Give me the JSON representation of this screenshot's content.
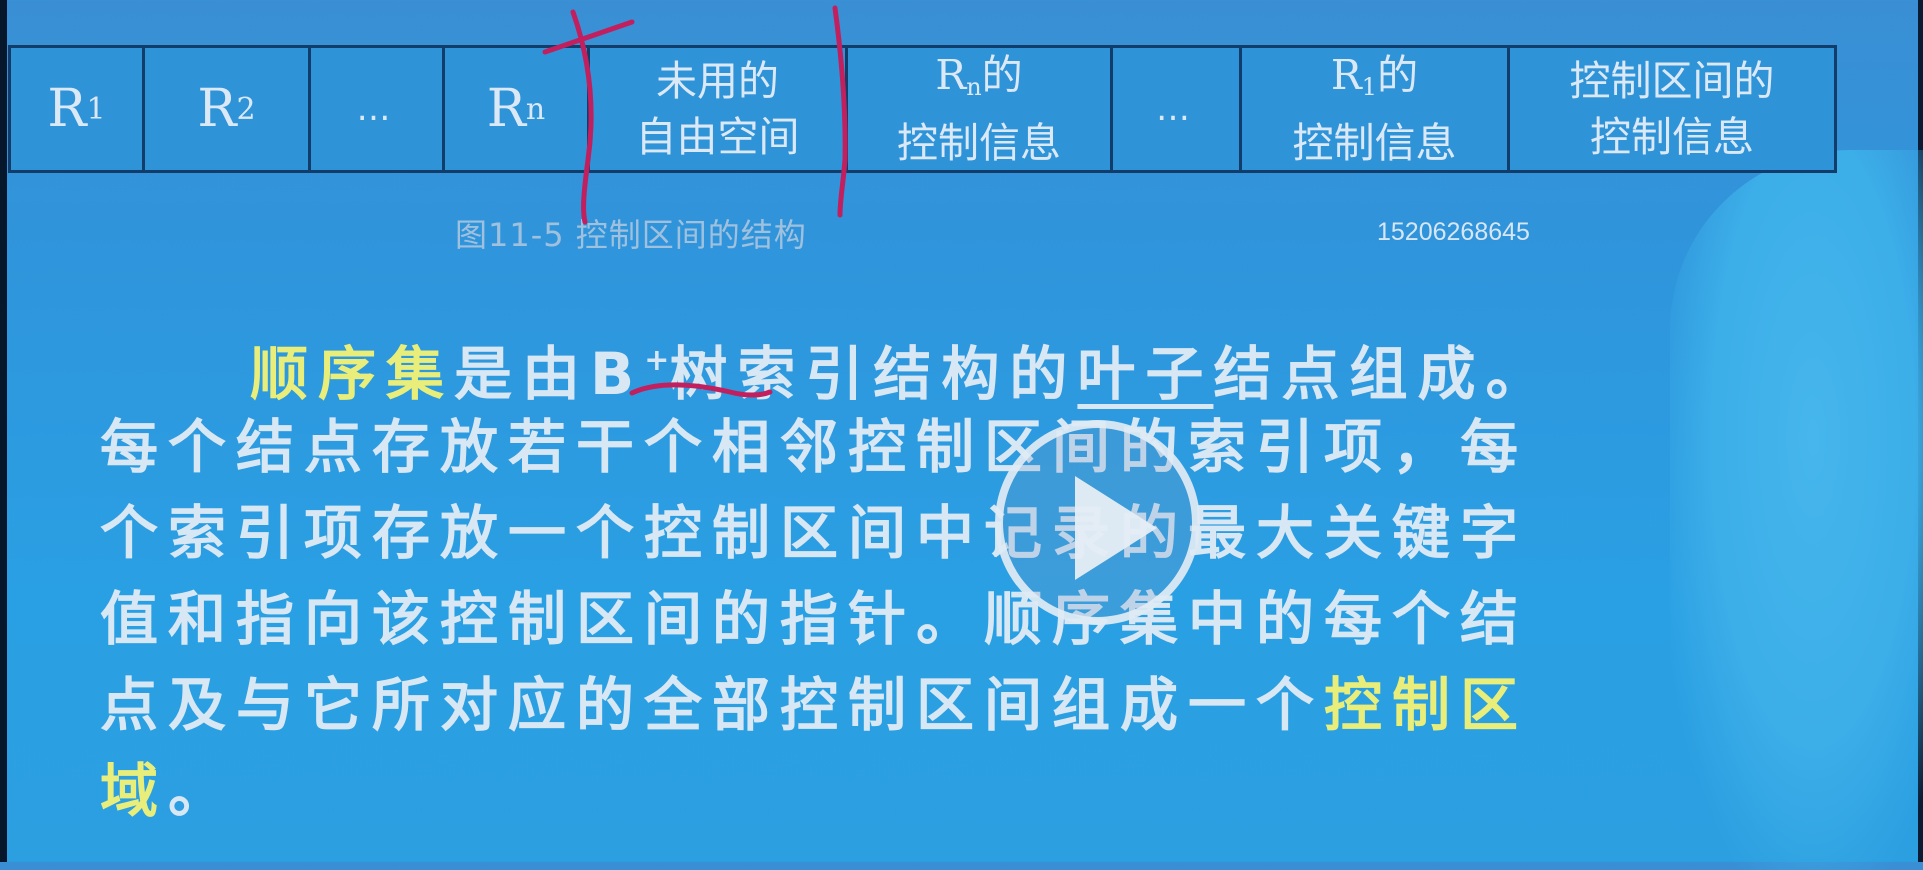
{
  "table": {
    "cells": [
      {
        "main": "R",
        "sub": "1"
      },
      {
        "main": "R",
        "sub": "2"
      },
      {
        "dots": "…"
      },
      {
        "main": "R",
        "sub": "n"
      },
      {
        "line1": "未用的",
        "line2": "自由空间"
      },
      {
        "r": "R",
        "rsub": "n",
        "rtail": "的",
        "line2": "控制信息"
      },
      {
        "dots": "…"
      },
      {
        "r": "R",
        "rsub": "1",
        "rtail": "的",
        "line2": "控制信息"
      },
      {
        "line1": "控制区间的",
        "line2": "控制信息"
      }
    ]
  },
  "caption": "图11-5   控制区间的结构",
  "phone_number": "15206268645",
  "paragraph": {
    "l1_hl": "顺序集",
    "l1_a": "是由",
    "l1_b": "B",
    "l1_sup": "+",
    "l1_c": "树",
    "l1_d": "索引结构的",
    "l1_e": "叶子",
    "l1_f": "结点组成。",
    "l2": "每个结点存放若干个相邻控制区间的索引项，每",
    "l3": "个索引项存放一个控制区间中记录的最大关键字",
    "l4": "值和指向该控制区间的指针。顺序集中的每个结",
    "l5_a": "点及与它所对应的全部控制区间组成一个",
    "l5_hl": "控制区",
    "l6_hl": "域",
    "l6_b": "。"
  },
  "colors": {
    "background": "#2f95dc",
    "text": "#d8e7f4",
    "highlight": "#e9ee7a",
    "ink": "#c21f5e",
    "cell_border": "#123c6a"
  },
  "icons": [
    "play-icon"
  ]
}
